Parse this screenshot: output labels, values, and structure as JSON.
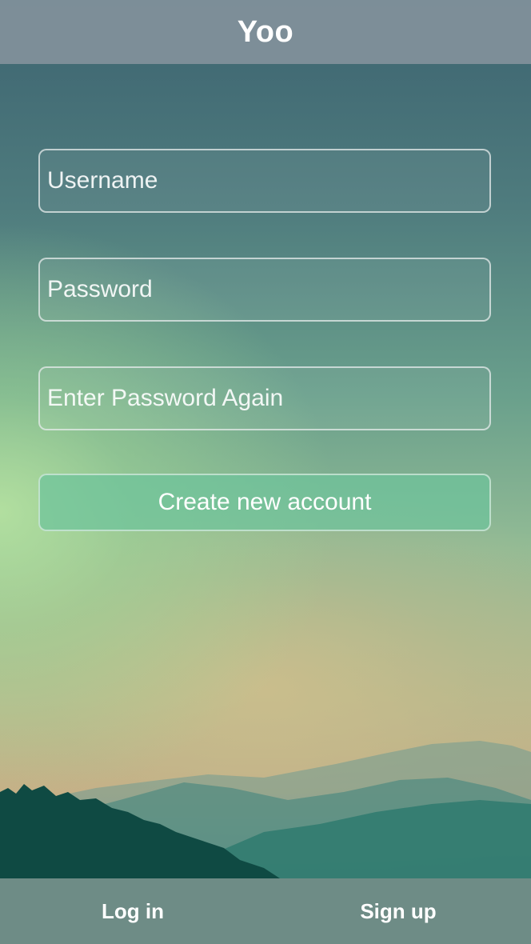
{
  "header": {
    "title": "Yoo"
  },
  "form": {
    "username_placeholder": "Username",
    "password_placeholder": "Password",
    "password_again_placeholder": "Enter Password Again",
    "create_button_label": "Create new account"
  },
  "footer": {
    "tabs": [
      {
        "label": "Log in"
      },
      {
        "label": "Sign up"
      }
    ]
  },
  "colors": {
    "header_bg": "#82919b",
    "button_bg": "#6ec39b",
    "footer_bg": "#78918c",
    "text": "#ffffff"
  }
}
